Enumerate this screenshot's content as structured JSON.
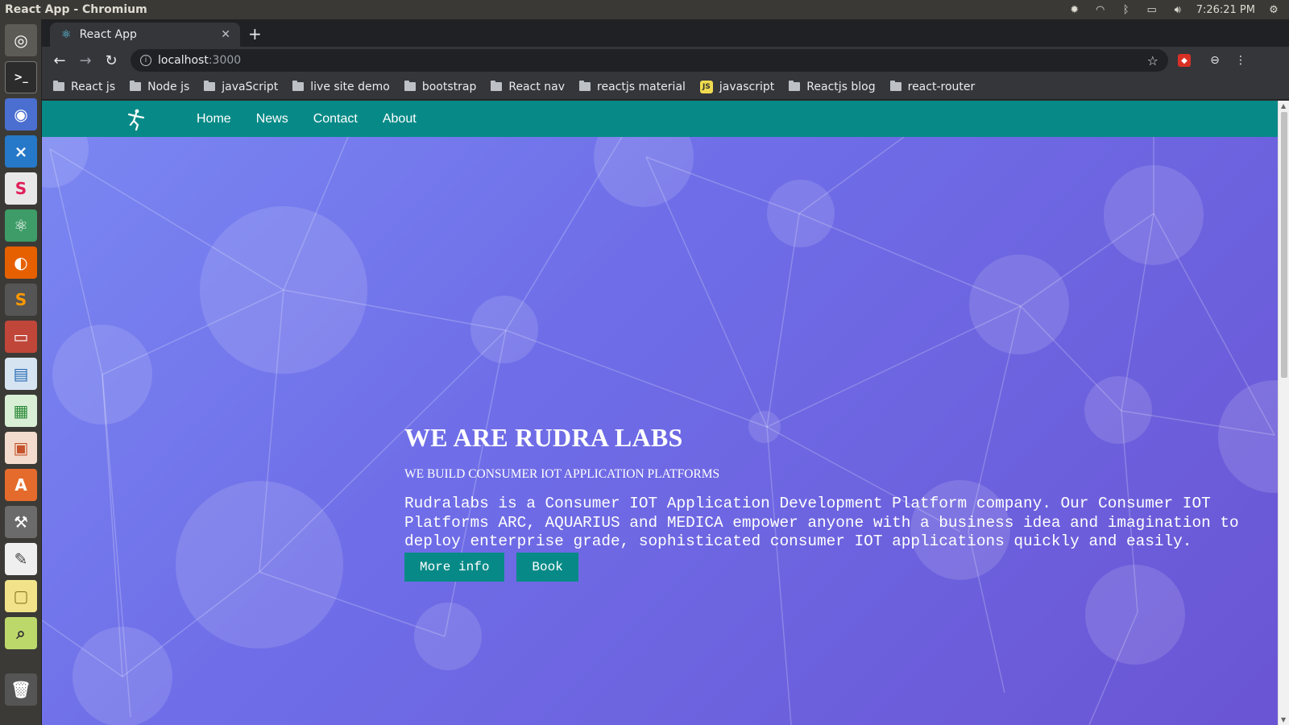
{
  "system_bar": {
    "window_title": "React App - Chromium",
    "clock": "7:26:21 PM"
  },
  "browser": {
    "tab": {
      "title": "React App",
      "favicon": "react-icon"
    },
    "address": {
      "host": "localhost",
      "port": ":3000"
    },
    "bookmarks": [
      {
        "label": "React js",
        "icon": "folder-icon"
      },
      {
        "label": "Node js",
        "icon": "folder-icon"
      },
      {
        "label": "javaScript",
        "icon": "folder-icon"
      },
      {
        "label": "live site demo",
        "icon": "folder-icon"
      },
      {
        "label": "bootstrap",
        "icon": "folder-icon"
      },
      {
        "label": "React nav",
        "icon": "folder-icon"
      },
      {
        "label": "reactjs material",
        "icon": "folder-icon"
      },
      {
        "label": "javascript",
        "icon": "js-icon"
      },
      {
        "label": "Reactjs blog",
        "icon": "folder-icon"
      },
      {
        "label": "react-router",
        "icon": "folder-icon"
      }
    ]
  },
  "app": {
    "nav": {
      "links": [
        "Home",
        "News",
        "Contact",
        "About"
      ]
    },
    "hero": {
      "title": "WE ARE RUDRA LABS",
      "subtitle": "WE BUILD CONSUMER IOT APPLICATION PLATFORMS",
      "description_lines": [
        "Rudralabs is a Consumer IOT Application Development Platform company. Our Consumer IOT",
        "Platforms ARC, AQUARIUS and MEDICA empower anyone with a business idea and imagination to",
        "deploy enterprise grade, sophisticated consumer IOT applications quickly and easily."
      ],
      "buttons": {
        "more_info": "More info",
        "book": "Book"
      }
    }
  },
  "colors": {
    "nav_bg": "#078a87",
    "hero_gradient_start": "#7b88f2",
    "hero_gradient_end": "#6a55d4"
  }
}
